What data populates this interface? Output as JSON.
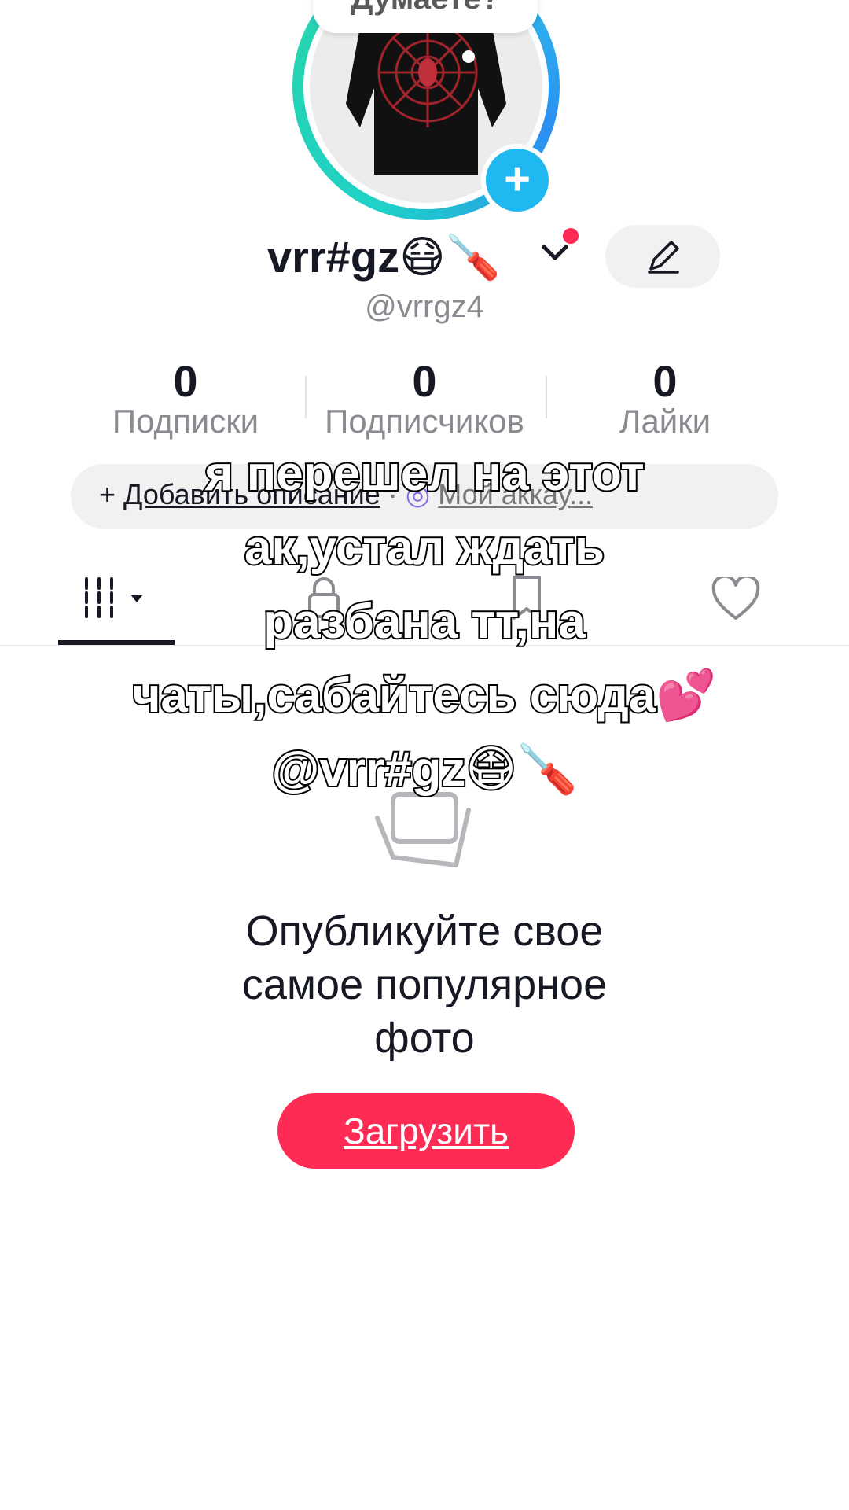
{
  "profile": {
    "avatar_bubble": "Думаете?",
    "add_avatar_icon": "plus-icon",
    "display_name": "vrr#gz",
    "name_emojis": "😷🪛",
    "handle": "@vrrgz4",
    "edit_icon": "pencil-icon"
  },
  "stats": [
    {
      "value": "0",
      "label": "Подписки"
    },
    {
      "value": "0",
      "label": "Подписчиков"
    },
    {
      "value": "0",
      "label": "Лайки"
    }
  ],
  "description": {
    "add_prefix": "+ ",
    "add_label": "Добавить описание",
    "separator": " · ",
    "account_label": "Мой аккау..."
  },
  "tabs": {
    "videos_icon": "grid-icon",
    "private_icon": "lock-icon",
    "saved_icon": "bookmark-icon",
    "liked_icon": "heart-icon"
  },
  "empty_state": {
    "line1": "Опубликуйте свое",
    "line2": "самое популярное",
    "line3": "фото",
    "upload_label": "Загрузить"
  },
  "overlay": {
    "line1": "я перешел на этот",
    "line2": "ак,устал ждать",
    "line3": "разбана тт,на",
    "line4": "чаты,сабайтесь сюда💕",
    "line5": "@vrr#gz😷🪛"
  },
  "colors": {
    "accent": "#fe2c55",
    "ring_start": "#1fd1c7",
    "ring_end": "#2b8ff2",
    "badge": "#20b8f0"
  }
}
